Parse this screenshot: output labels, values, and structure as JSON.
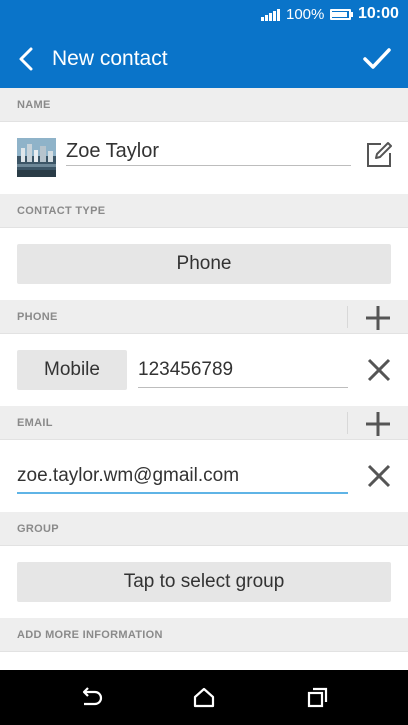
{
  "status_bar": {
    "battery_percent": "100%",
    "time": "10:00"
  },
  "app_bar": {
    "title": "New contact"
  },
  "sections": {
    "name": "NAME",
    "contact_type": "CONTACT TYPE",
    "phone": "PHONE",
    "email": "EMAIL",
    "group": "GROUP",
    "more_info": "ADD MORE INFORMATION"
  },
  "name_field": {
    "value": "Zoe Taylor"
  },
  "contact_type": {
    "value": "Phone"
  },
  "phone_entry": {
    "type_label": "Mobile",
    "number": "123456789"
  },
  "email_entry": {
    "address": "zoe.taylor.wm@gmail.com"
  },
  "group": {
    "button_label": "Tap to select group"
  },
  "colors": {
    "accent": "#0a74c9",
    "focus_underline": "#5fb4e6"
  },
  "icons": [
    "signal-icon",
    "battery-icon",
    "back-icon",
    "checkmark-icon",
    "edit-icon",
    "plus-icon",
    "close-icon",
    "nav-back-icon",
    "home-icon",
    "recents-icon"
  ]
}
